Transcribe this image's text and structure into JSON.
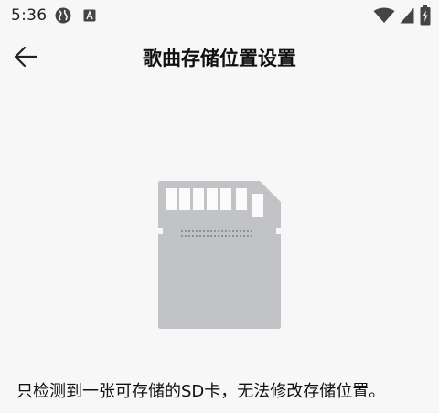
{
  "status_bar": {
    "time": "5:36",
    "icons": [
      "globe-icon",
      "font-icon",
      "wifi-icon",
      "cell-signal-icon",
      "battery-icon"
    ]
  },
  "app_bar": {
    "back_icon": "arrow-left-icon",
    "title": "歌曲存储位置设置"
  },
  "illustration": {
    "icon": "sd-card-icon",
    "color": "#c1c3c6"
  },
  "message": "只检测到一张可存储的SD卡，无法修改存储位置。"
}
